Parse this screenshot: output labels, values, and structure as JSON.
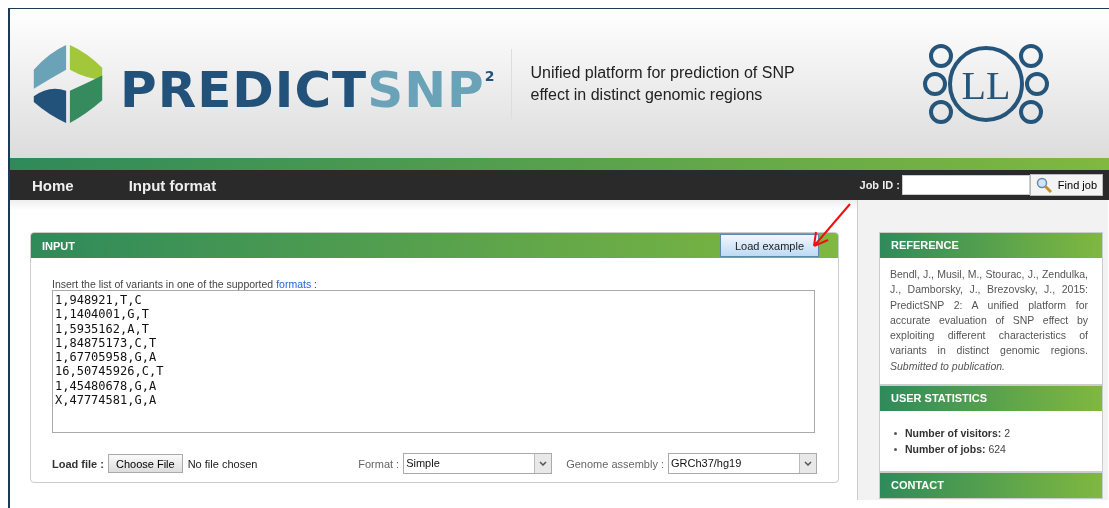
{
  "header": {
    "logo_dark": "PREDICT",
    "logo_light": "SNP",
    "logo_sup": "2",
    "tagline": [
      "Unified platform for prediction of SNP",
      "effect in distinct genomic regions"
    ],
    "lab_logo": "LL"
  },
  "nav": {
    "items": [
      {
        "label": "Home"
      },
      {
        "label": "Input format"
      }
    ],
    "job_label": "Job ID :",
    "find_button": "Find job"
  },
  "input_panel": {
    "title": "INPUT",
    "load_example": "Load example",
    "instruction": "Insert the list of variants in one of the supported",
    "link": "formats",
    "colon": ":",
    "variants": [
      "1,948921,T,C",
      "1,1404001,G,T",
      "1,5935162,A,T",
      "1,84875173,C,T",
      "1,67705958,G,A",
      "16,50745926,C,T",
      "1,45480678,G,A",
      "X,47774581,G,A"
    ],
    "load_file_label": "Load file :",
    "choose_file": "Choose File",
    "file_status": "No file chosen",
    "format_label": "Format :",
    "format_value": "Simple",
    "assembly_label": "Genome assembly :",
    "assembly_value": "GRCh37/hg19"
  },
  "reference": {
    "title": "REFERENCE",
    "text": "Bendl, J., Musil, M., Stourac, J., Zendulka, J., Damborsky, J., Brezovsky, J., 2015: PredictSNP 2: A unified platform for accurate evaluation of SNP effect by exploiting different characteristics of variants in distinct genomic regions. *Submitted to publication.*"
  },
  "user_statistics": {
    "title": "USER STATISTICS",
    "items": [
      {
        "label": "Number of visitors:",
        "value": "2"
      },
      {
        "label": "Number of jobs:",
        "value": "624"
      }
    ]
  },
  "contact": {
    "title": "CONTACT"
  }
}
